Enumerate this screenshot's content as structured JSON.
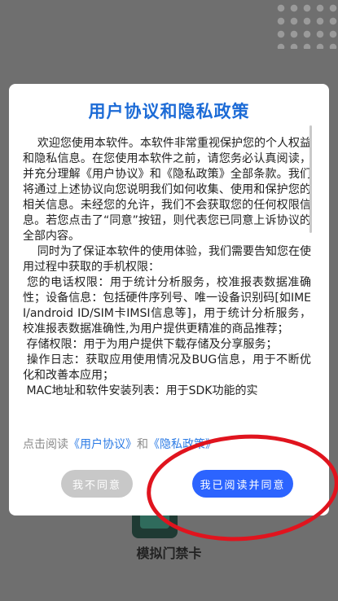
{
  "background": {
    "app_label": "模拟门禁卡"
  },
  "dialog": {
    "title": "用户协议和隐私政策",
    "body": "    欢迎您使用本软件。本软件非常重视保护您的个人权益和隐私信息。在您使用本软件之前，请您务必认真阅读，并充分理解《用户协议》和《隐私政策》全部条款。我们将通过上述协议向您说明我们如何收集、使用和保护您的相关信息。未经您的允许，我们不会获取您的任何权限信息。若您点击了“同意”按钮，则代表您已同意上诉协议的全部内容。\n    同时为了保证本软件的使用体验，我们需要告知您在使用过程中获取的手机权限：\n 您的电话权限：用于统计分析服务，校准报表数据准确性；设备信息：包括硬件序列号、唯一设备识别码[如IMEI/android ID/SIM卡IMSI信息等]，用于统计分析服务，校准报表数据准确性,为用户提供更精准的商品推荐；\n 存储权限：用于为用户提供下载存储及分享服务；\n 操作日志：获取应用使用情况及BUG信息，用于不断优化和改善本应用；\n MAC地址和软件安装列表：用于SDK功能的实",
    "links_prefix": "点击阅读",
    "user_agreement_link": "《用户协议》",
    "and_text": "和",
    "privacy_policy_link": "《隐私政策》",
    "disagree_label": "我不同意",
    "agree_label": "我已阅读并同意"
  },
  "colors": {
    "title": "#1c6bd6",
    "agree_button": "#2c64ff",
    "disagree_button": "#c8c8c8",
    "annotation": "#e0141e"
  }
}
